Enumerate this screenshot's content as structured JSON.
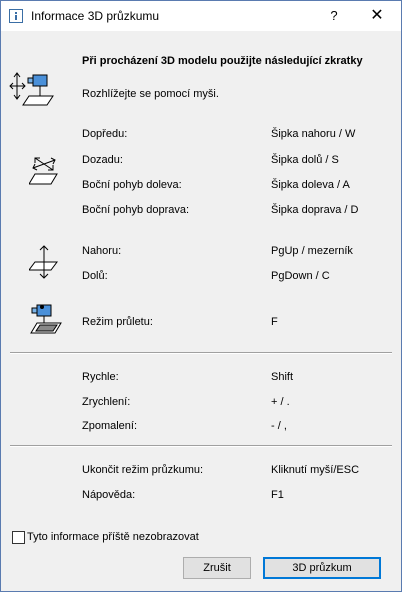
{
  "window": {
    "title": "Informace 3D průzkumu",
    "help_label": "?",
    "close_label": "✕"
  },
  "intro": {
    "heading": "Při procházení 3D modelu použijte následující zkratky",
    "look": "Rozhlížejte se pomocí myši."
  },
  "movement": [
    {
      "label": "Dopředu:",
      "key": "Šipka nahoru / W"
    },
    {
      "label": "Dozadu:",
      "key": "Šipka dolů / S"
    },
    {
      "label": "Boční pohyb doleva:",
      "key": "Šipka doleva / A"
    },
    {
      "label": "Boční pohyb doprava:",
      "key": "Šipka doprava / D"
    }
  ],
  "vertical": [
    {
      "label": "Nahoru:",
      "key": "PgUp / mezerník"
    },
    {
      "label": "Dolů:",
      "key": "PgDown / C"
    }
  ],
  "flight": {
    "label": "Režim průletu:",
    "key": "F"
  },
  "speed": [
    {
      "label": "Rychle:",
      "key": "Shift"
    },
    {
      "label": "Zrychlení:",
      "key": "+ / ."
    },
    {
      "label": "Zpomalení:",
      "key": "- / ,"
    }
  ],
  "misc": [
    {
      "label": "Ukončit režim průzkumu:",
      "key": "Kliknutí myší/ESC"
    },
    {
      "label": "Nápověda:",
      "key": "F1"
    }
  ],
  "footer": {
    "checkbox_label": "Tyto informace příště nezobrazovat",
    "cancel_label": "Zrušit",
    "confirm_label": "3D průzkum"
  }
}
